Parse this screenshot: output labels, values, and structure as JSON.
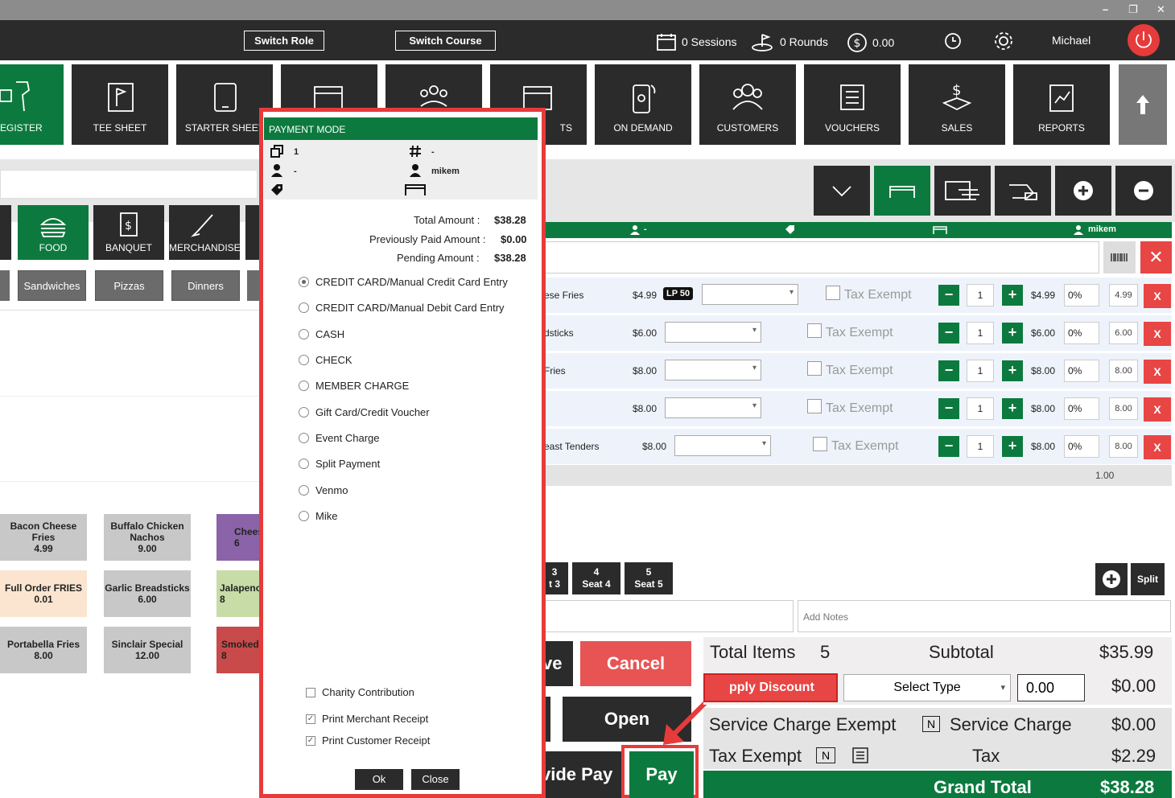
{
  "window": {
    "minimize": "–",
    "restore": "❐",
    "close": "✕"
  },
  "header": {
    "switch_role": "Switch Role",
    "switch_course": "Switch Course",
    "sessions": "0 Sessions",
    "rounds": "0 Rounds",
    "balance": "0.00",
    "user": "Michael"
  },
  "nav": [
    {
      "label": "EGISTER"
    },
    {
      "label": "TEE SHEET"
    },
    {
      "label": "STARTER SHEET"
    },
    {
      "label": ""
    },
    {
      "label": ""
    },
    {
      "label": "TS"
    },
    {
      "label": "ON DEMAND"
    },
    {
      "label": "CUSTOMERS"
    },
    {
      "label": "VOUCHERS"
    },
    {
      "label": "SALES"
    },
    {
      "label": "REPORTS"
    }
  ],
  "categories": [
    {
      "label": "FOOD"
    },
    {
      "label": "BANQUET"
    },
    {
      "label": "MERCHANDISE"
    }
  ],
  "subcategories": [
    "Sandwiches",
    "Pizzas",
    "Dinners"
  ],
  "items": [
    {
      "name": "Bacon Cheese Fries",
      "price": "4.99"
    },
    {
      "name": "Buffalo Chicken Nachos",
      "price": "9.00"
    },
    {
      "name": "Chees",
      "price": "6"
    },
    {
      "name": "Full Order FRIES",
      "price": "0.01"
    },
    {
      "name": "Garlic Breadsticks",
      "price": "6.00"
    },
    {
      "name": "Jalapeno",
      "price": "8"
    },
    {
      "name": "Portabella Fries",
      "price": "8.00"
    },
    {
      "name": "Sinclair Special",
      "price": "12.00"
    },
    {
      "name": "Smoked",
      "price": "8"
    }
  ],
  "order_header": {
    "player": "-",
    "user": "mikem"
  },
  "order_rows": [
    {
      "name": "ese Fries",
      "price": "$4.99",
      "badge": "LP 50",
      "tax_label": "Tax Exempt",
      "qty": "1",
      "total": "$4.99",
      "discount": "0%",
      "amount": "4.99",
      "delete": "X"
    },
    {
      "name": "dsticks",
      "price": "$6.00",
      "badge": "",
      "tax_label": "Tax Exempt",
      "qty": "1",
      "total": "$6.00",
      "discount": "0%",
      "amount": "6.00",
      "delete": "X"
    },
    {
      "name": "Fries",
      "price": "$8.00",
      "badge": "",
      "tax_label": "Tax Exempt",
      "qty": "1",
      "total": "$8.00",
      "discount": "0%",
      "amount": "8.00",
      "delete": "X"
    },
    {
      "name": "",
      "price": "$8.00",
      "badge": "",
      "tax_label": "Tax Exempt",
      "qty": "1",
      "total": "$8.00",
      "discount": "0%",
      "amount": "8.00",
      "delete": "X"
    },
    {
      "name": "east Tenders",
      "price": "$8.00",
      "badge": "",
      "tax_label": "Tax Exempt",
      "qty": "1",
      "total": "$8.00",
      "discount": "0%",
      "amount": "8.00",
      "delete": "X"
    }
  ],
  "order_footer_value": "1.00",
  "seats": [
    {
      "num": "3",
      "label": "t 3"
    },
    {
      "num": "4",
      "label": "Seat 4"
    },
    {
      "num": "5",
      "label": "Seat 5"
    }
  ],
  "split_label": "Split",
  "notes_placeholder": "Add Notes",
  "actions": {
    "save": "ve",
    "cancel": "Cancel",
    "open": "Open",
    "divide_pay": "vide Pay",
    "pay": "Pay"
  },
  "totals": {
    "total_items_label": "Total Items",
    "total_items": "5",
    "subtotal_label": "Subtotal",
    "subtotal": "$35.99",
    "apply_discount": "pply Discount",
    "select_type": "Select Type",
    "discount_value": "0.00",
    "discount_total": "$0.00",
    "service_exempt_label": "Service Charge Exempt",
    "service_charge_label": "Service Charge",
    "service_charge": "$0.00",
    "tax_exempt_label": "Tax Exempt",
    "flag_n": "N",
    "tax_label": "Tax",
    "tax": "$2.29",
    "grand_total_label": "Grand Total",
    "grand_total": "$38.28"
  },
  "dialog": {
    "title": "PAYMENT MODE",
    "info_count": "1",
    "info_hash": "-",
    "info_player": "-",
    "info_user": "mikem",
    "total_label": "Total Amount :",
    "total": "$38.28",
    "prev_label": "Previously Paid Amount :",
    "prev": "$0.00",
    "pending_label": "Pending Amount :",
    "pending": "$38.28",
    "modes": [
      "CREDIT CARD/Manual Credit Card Entry",
      "CREDIT CARD/Manual Debit Card Entry",
      "CASH",
      "CHECK",
      "MEMBER CHARGE",
      "Gift Card/Credit Voucher",
      "Event Charge",
      "Split Payment",
      "Venmo",
      "Mike"
    ],
    "charity": "Charity Contribution",
    "print_merchant": "Print Merchant Receipt",
    "print_customer": "Print Customer Receipt",
    "ok": "Ok",
    "close": "Close"
  },
  "colors": {
    "green": "#0c7a3e",
    "red": "#e84545",
    "dark": "#2b2b2b"
  }
}
